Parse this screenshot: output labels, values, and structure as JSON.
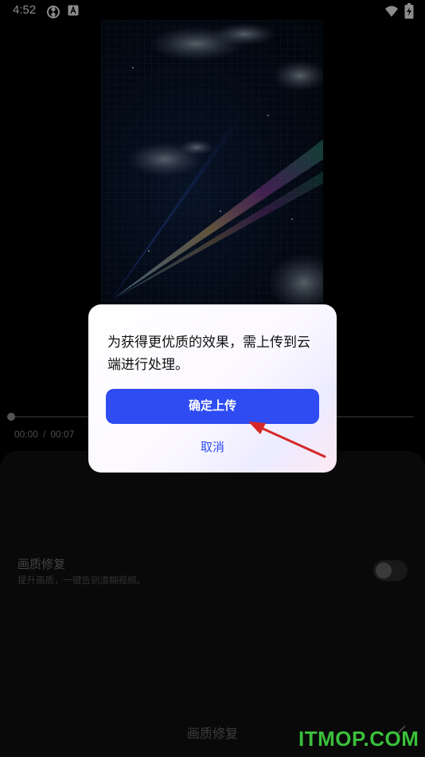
{
  "status_bar": {
    "time": "4:52",
    "icons": [
      "sync-icon",
      "a-icon",
      "wifi-icon",
      "battery-charging-icon"
    ]
  },
  "player": {
    "current_time": "00:00",
    "separator": "/",
    "duration": "00:07",
    "progress": 0.0
  },
  "panel": {
    "feature_title": "画质修复",
    "feature_desc": "提升画质，一键告别渣糊视频。",
    "toggle_on": false,
    "tab_label": "画质修复"
  },
  "dialog": {
    "message": "为获得更优质的效果，需上传到云端进行处理。",
    "confirm_label": "确定上传",
    "cancel_label": "取消"
  },
  "watermark": "ITMOP.COM",
  "colors": {
    "accent": "#2e4cf2",
    "arrow": "#d62828",
    "watermark": "#3bbf3b"
  }
}
